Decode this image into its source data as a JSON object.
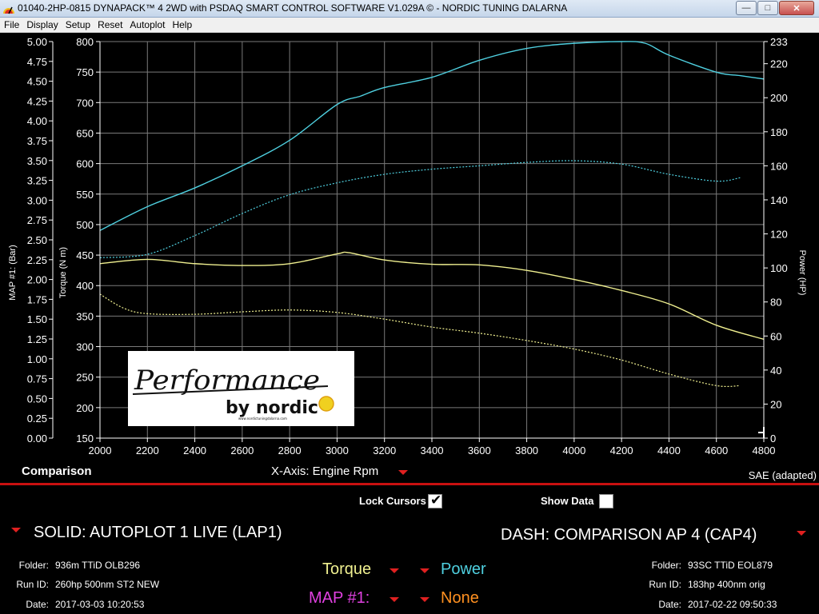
{
  "window": {
    "title": "01040-2HP-0815 DYNAPACK™ 4 2WD with PSDAQ SMART CONTROL SOFTWARE V1.029A © - NORDIC TUNING DALARNA",
    "minimize": "—",
    "maximize": "□",
    "close": "✕"
  },
  "menu": [
    "File",
    "Display",
    "Setup",
    "Reset",
    "Autoplot",
    "Help"
  ],
  "chart_data": {
    "type": "line",
    "xlabel": "",
    "x_ticks": [
      2000,
      2200,
      2400,
      2600,
      2800,
      3000,
      3200,
      3400,
      3600,
      3800,
      4000,
      4200,
      4400,
      4600,
      4800
    ],
    "xlim": [
      2000,
      4800
    ],
    "map_axis": {
      "label": "MAP #1: (Bar)",
      "ticks": [
        "5.00",
        "4.75",
        "4.50",
        "4.25",
        "4.00",
        "3.75",
        "3.50",
        "3.25",
        "3.00",
        "2.75",
        "2.50",
        "2.25",
        "2.00",
        "1.75",
        "1.50",
        "1.25",
        "1.00",
        "0.75",
        "0.50",
        "0.25",
        "0.00"
      ]
    },
    "torque_axis": {
      "label": "Torque (N m)",
      "ticks": [
        800,
        750,
        700,
        650,
        600,
        550,
        500,
        450,
        400,
        350,
        300,
        250,
        200,
        150
      ],
      "ylim": [
        150,
        800
      ]
    },
    "power_axis": {
      "label": "Power (HP)",
      "ticks": [
        233,
        220,
        200,
        180,
        160,
        140,
        120,
        100,
        80,
        60,
        40,
        20,
        0
      ],
      "ylim": [
        0,
        233
      ]
    },
    "series": [
      {
        "name": "Power (SOLID)",
        "axis": "power",
        "style": "solid",
        "color": "#4fd0e0",
        "x": [
          2000,
          2200,
          2400,
          2600,
          2800,
          3000,
          3100,
          3200,
          3400,
          3600,
          3800,
          4000,
          4200,
          4300,
          4400,
          4600,
          4700,
          4800
        ],
        "y": [
          122,
          136,
          147,
          160,
          175,
          196,
          201,
          206,
          212,
          222,
          229,
          232,
          233,
          232,
          225,
          215,
          213,
          211
        ]
      },
      {
        "name": "Torque (SOLID)",
        "axis": "torque",
        "style": "solid",
        "color": "#f0f090",
        "x": [
          2000,
          2200,
          2400,
          2600,
          2800,
          3000,
          3050,
          3200,
          3400,
          3600,
          3800,
          4000,
          4200,
          4400,
          4600,
          4800
        ],
        "y": [
          436,
          443,
          436,
          433,
          436,
          452,
          454,
          442,
          435,
          434,
          425,
          410,
          392,
          370,
          335,
          312
        ]
      },
      {
        "name": "Power (DASH)",
        "axis": "power",
        "style": "dash",
        "color": "#4fd0e0",
        "x": [
          2000,
          2200,
          2400,
          2600,
          2800,
          3000,
          3200,
          3400,
          3600,
          3800,
          4000,
          4200,
          4400,
          4600,
          4700
        ],
        "y": [
          106,
          108,
          119,
          132,
          143,
          150,
          155,
          158,
          160,
          162,
          163,
          161,
          155,
          151,
          153
        ]
      },
      {
        "name": "Torque (DASH)",
        "axis": "torque",
        "style": "dash",
        "color": "#f0f090",
        "x": [
          2000,
          2100,
          2200,
          2400,
          2600,
          2800,
          3000,
          3200,
          3400,
          3600,
          3800,
          4000,
          4200,
          4400,
          4600,
          4700
        ],
        "y": [
          386,
          363,
          354,
          353,
          357,
          360,
          356,
          345,
          332,
          322,
          310,
          296,
          278,
          255,
          236,
          236
        ]
      }
    ],
    "grid": true
  },
  "logo": {
    "line1": "Performance",
    "line2": "by nordic",
    "url": "www.nordictuningdalarna.com"
  },
  "panel": {
    "comparison_label": "Comparison",
    "xaxis_label": "X-Axis: Engine Rpm",
    "sae_label": "SAE (adapted)",
    "lock_cursors": "Lock Cursors",
    "lock_cursors_checked": true,
    "show_data": "Show Data",
    "show_data_checked": false,
    "checkmark": "✔",
    "solid_run": "SOLID: AUTOPLOT 1 LIVE (LAP1)",
    "dash_run": "DASH: COMPARISON AP 4 (CAP4)",
    "left_info": {
      "folder_key": "Folder:",
      "folder": "936m TTiD OLB296",
      "runid_key": "Run ID:",
      "runid": "260hp 500nm ST2 NEW",
      "date_key": "Date:",
      "date": "2017-03-03 10:20:53"
    },
    "right_info": {
      "folder_key": "Folder:",
      "folder": "93SC TTiD EOL879",
      "runid_key": "Run ID:",
      "runid": "183hp 400nm orig",
      "date_key": "Date:",
      "date": "2017-02-22 09:50:33"
    },
    "selectors": {
      "torque": "Torque",
      "power": "Power",
      "map": "MAP #1:",
      "none": "None"
    },
    "colors": {
      "torque": "#f0f090",
      "power": "#4fd0e0",
      "map": "#e040e0",
      "none": "#ff9020",
      "accent": "#c81010"
    }
  }
}
